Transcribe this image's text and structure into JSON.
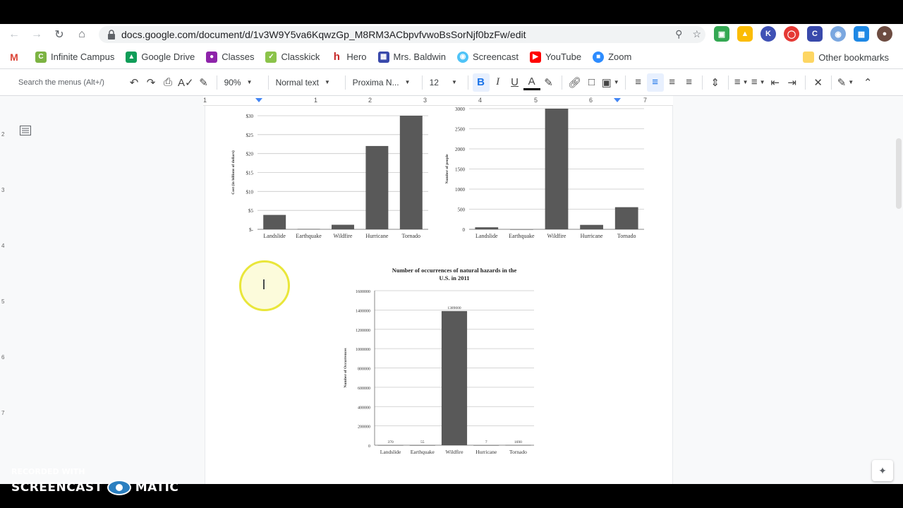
{
  "browser": {
    "url": "docs.google.com/document/d/1v3W9Y5va6KqwzGp_M8RM3ACbpvfvwoBsSorNjf0bzFw/edit"
  },
  "bookmarks": {
    "items": [
      {
        "label": "",
        "icon": "gmail-icon",
        "color": "#db4437"
      },
      {
        "label": "Infinite Campus",
        "icon": "infinite-campus-icon",
        "color": "#7cb342"
      },
      {
        "label": "Google Drive",
        "icon": "google-drive-icon",
        "color": "#0f9d58"
      },
      {
        "label": "Classes",
        "icon": "classes-icon",
        "color": "#8e24aa"
      },
      {
        "label": "Classkick",
        "icon": "classkick-icon",
        "color": "#8bc34a"
      },
      {
        "label": "Hero",
        "icon": "hero-icon",
        "color": "#c62828"
      },
      {
        "label": "Mrs. Baldwin",
        "icon": "mrs-baldwin-icon",
        "color": "#3949ab"
      },
      {
        "label": "Screencast",
        "icon": "screencast-icon",
        "color": "#4fc3f7"
      },
      {
        "label": "YouTube",
        "icon": "youtube-icon",
        "color": "#ff0000"
      },
      {
        "label": "Zoom",
        "icon": "zoom-icon",
        "color": "#2d8cff"
      }
    ],
    "other": "Other bookmarks"
  },
  "toolbar": {
    "search_placeholder": "Search the menus (Alt+/)",
    "zoom": "90%",
    "style": "Normal text",
    "font": "Proxima N...",
    "size": "12"
  },
  "ruler": {
    "marks": [
      "1",
      "1",
      "2",
      "3",
      "4",
      "5",
      "6",
      "7"
    ],
    "vmarks": [
      "2",
      "3",
      "4",
      "5",
      "6",
      "7"
    ]
  },
  "charts": {
    "cost": {
      "type": "bar",
      "ylabel": "Cost (in billions of dollars)",
      "ticks": [
        "$-",
        "$5",
        "$10",
        "$15",
        "$20",
        "$25",
        "$30"
      ],
      "categories": [
        "Landslide",
        "Earthquake",
        "Wildfire",
        "Hurricane",
        "Tornado"
      ],
      "values": [
        3.8,
        0.1,
        1.2,
        22,
        31
      ],
      "ylim": [
        0,
        30
      ]
    },
    "deaths": {
      "type": "bar",
      "ylabel": "Number of people",
      "ticks": [
        "0",
        "500",
        "1000",
        "1500",
        "2000",
        "2500",
        "3000"
      ],
      "categories": [
        "Landslide",
        "Earthquake",
        "Wildfire",
        "Hurricane",
        "Tornado"
      ],
      "values": [
        50,
        0,
        3000,
        110,
        550
      ],
      "ylim": [
        0,
        3000
      ]
    },
    "occurrences": {
      "type": "bar",
      "title_line1": "Number of occurrences of natural hazards in the",
      "title_line2": "U.S. in 2011",
      "ylabel": "Number of Occurrences",
      "ticks": [
        "0",
        "200000",
        "400000",
        "600000",
        "800000",
        "1000000",
        "1200000",
        "1400000",
        "1600000"
      ],
      "categories": [
        "Landslide",
        "Earthquake",
        "Wildfire",
        "Hurricane",
        "Tornado"
      ],
      "values": [
        370,
        55,
        1389000,
        7,
        1690
      ],
      "labels": [
        "370",
        "55",
        "1389000",
        "7",
        "1690"
      ],
      "ylim": [
        0,
        1600000
      ]
    }
  },
  "watermark": {
    "line1": "RECORDED WITH",
    "left": "SCREENCAST",
    "right": "MATIC"
  }
}
